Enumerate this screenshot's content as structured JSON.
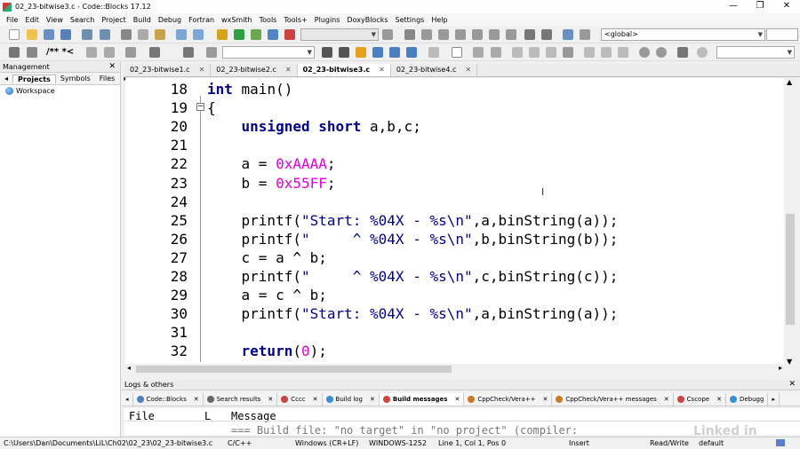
{
  "window": {
    "title": "02_23-bitwise3.c - Code::Blocks 17.12",
    "minimize": "—",
    "maximize": "❐",
    "close": "✕"
  },
  "menu": [
    "File",
    "Edit",
    "View",
    "Search",
    "Project",
    "Build",
    "Debug",
    "Fortran",
    "wxSmith",
    "Tools",
    "Tools+",
    "Plugins",
    "DoxyBlocks",
    "Settings",
    "Help"
  ],
  "toolbar": {
    "scope_combo": "<global>",
    "comment_buttons": "/** *<"
  },
  "management": {
    "title": "Management",
    "tabs": [
      "Projects",
      "Symbols",
      "Files"
    ],
    "active_tab": "Projects",
    "tree_root": "Workspace"
  },
  "file_tabs": [
    {
      "label": "02_23-bitwise1.c",
      "active": false
    },
    {
      "label": "02_23-bitwise2.c",
      "active": false
    },
    {
      "label": "02_23-bitwise3.c",
      "active": true
    },
    {
      "label": "02_23-bitwise4.c",
      "active": false
    }
  ],
  "editor": {
    "line_numbers": [
      "18",
      "19",
      "20",
      "21",
      "22",
      "23",
      "24",
      "25",
      "26",
      "27",
      "28",
      "29",
      "30",
      "31",
      "32"
    ],
    "lines": [
      {
        "parts": [
          {
            "t": "int",
            "c": "kw"
          },
          {
            "t": " main()",
            "c": ""
          }
        ]
      },
      {
        "parts": [
          {
            "t": "{",
            "c": ""
          }
        ]
      },
      {
        "parts": [
          {
            "t": "    ",
            "c": ""
          },
          {
            "t": "unsigned short",
            "c": "kw"
          },
          {
            "t": " a,b,c;",
            "c": ""
          }
        ]
      },
      {
        "parts": []
      },
      {
        "parts": [
          {
            "t": "    a = ",
            "c": ""
          },
          {
            "t": "0xAAAA",
            "c": "num"
          },
          {
            "t": ";",
            "c": ""
          }
        ]
      },
      {
        "parts": [
          {
            "t": "    b = ",
            "c": ""
          },
          {
            "t": "0x55FF",
            "c": "num"
          },
          {
            "t": ";",
            "c": ""
          }
        ]
      },
      {
        "parts": []
      },
      {
        "parts": [
          {
            "t": "    printf(",
            "c": ""
          },
          {
            "t": "\"Start: %04X - %s\\n\"",
            "c": "str"
          },
          {
            "t": ",a,binString(a));",
            "c": ""
          }
        ]
      },
      {
        "parts": [
          {
            "t": "    printf(",
            "c": ""
          },
          {
            "t": "\"     ^ %04X - %s\\n\"",
            "c": "str"
          },
          {
            "t": ",b,binString(b));",
            "c": ""
          }
        ]
      },
      {
        "parts": [
          {
            "t": "    c = a ^ b;",
            "c": ""
          }
        ]
      },
      {
        "parts": [
          {
            "t": "    printf(",
            "c": ""
          },
          {
            "t": "\"     ^ %04X - %s\\n\"",
            "c": "str"
          },
          {
            "t": ",c,binString(c));",
            "c": ""
          }
        ]
      },
      {
        "parts": [
          {
            "t": "    a = c ^ b;",
            "c": ""
          }
        ]
      },
      {
        "parts": [
          {
            "t": "    printf(",
            "c": ""
          },
          {
            "t": "\"Start: %04X - %s\\n\"",
            "c": "str"
          },
          {
            "t": ",a,binString(a));",
            "c": ""
          }
        ]
      },
      {
        "parts": []
      },
      {
        "parts": [
          {
            "t": "    ",
            "c": ""
          },
          {
            "t": "return",
            "c": "kw"
          },
          {
            "t": "(",
            "c": ""
          },
          {
            "t": "0",
            "c": "num"
          },
          {
            "t": ");",
            "c": ""
          }
        ]
      }
    ],
    "fold_marker": "−"
  },
  "logs": {
    "title": "Logs & others",
    "tabs": [
      {
        "label": "Code::Blocks",
        "color": "#4a7fc1",
        "active": false
      },
      {
        "label": "Search results",
        "color": "#666666",
        "active": false
      },
      {
        "label": "Cccc",
        "color": "#cc4444",
        "active": false
      },
      {
        "label": "Build log",
        "color": "#3a8fd0",
        "active": false
      },
      {
        "label": "Build messages",
        "color": "#d0463a",
        "active": true
      },
      {
        "label": "CppCheck/Vera++",
        "color": "#cc7a22",
        "active": false
      },
      {
        "label": "CppCheck/Vera++ messages",
        "color": "#cc7a22",
        "active": false
      },
      {
        "label": "Cscope",
        "color": "#cc4444",
        "active": false
      },
      {
        "label": "Debugg",
        "color": "#3a8fd0",
        "active": false
      }
    ],
    "columns": [
      "File",
      "L",
      "Message"
    ],
    "first_row": "=== Build file: \"no target\" in \"no project\" (compiler:"
  },
  "statusbar": {
    "path": "C:\\Users\\Dan\\Documents\\LiL\\Ch02\\02_23\\02_23-bitwise3.c",
    "language": "C/C++",
    "eol": "Windows (CR+LF)",
    "encoding": "WINDOWS-1252",
    "position": "Line 1, Col 1, Pos 0",
    "mode": "Insert",
    "access": "Read/Write",
    "profile": "default"
  },
  "watermark": "Linked in"
}
